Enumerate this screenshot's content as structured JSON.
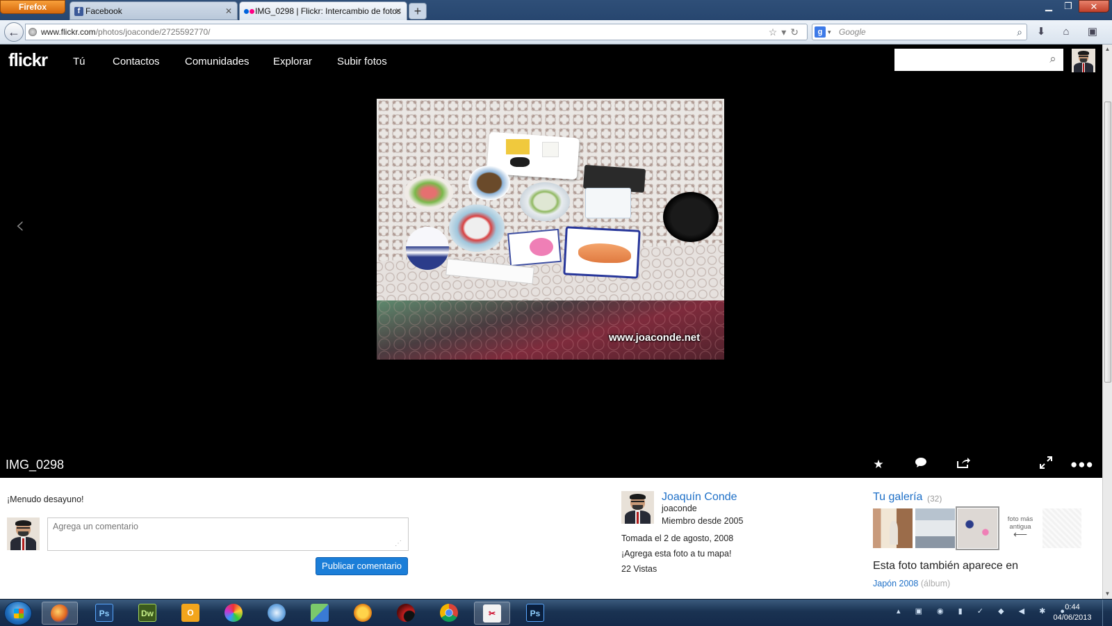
{
  "browser": {
    "app_button": "Firefox",
    "tabs": [
      {
        "label": "Facebook",
        "favicon": "facebook-icon",
        "active": false
      },
      {
        "label": "IMG_0298 | Flickr: Intercambio de fotos",
        "favicon": "flickr-icon",
        "active": true
      }
    ],
    "url_host": "www.flickr.com",
    "url_path": "/photos/joaconde/2725592770/",
    "search_engine": "Google",
    "search_placeholder": "Google"
  },
  "flickr": {
    "logo": "flickr",
    "nav": [
      "Tú",
      "Contactos",
      "Comunidades",
      "Explorar",
      "Subir fotos"
    ],
    "photo_title": "IMG_0298",
    "photo_watermark": "www.joaconde.net",
    "description": "¡Menudo desayuno!",
    "comment_placeholder": "Agrega un comentario",
    "post_button": "Publicar comentario",
    "owner": {
      "name": "Joaquín Conde",
      "username": "joaconde",
      "member_since": "Miembro desde 2005"
    },
    "taken_on": "Tomada el 2 de agosto, 2008",
    "add_to_map": "¡Agrega esta foto a tu mapa!",
    "views": "22 Vistas",
    "gallery": {
      "title": "Tu galería",
      "count": "(32)",
      "older_label": "foto más antigua",
      "older_arrow": "⟵"
    },
    "also_in": "Esta foto también aparece en",
    "album": {
      "name": "Japón 2008",
      "tag": "(álbum)"
    }
  },
  "taskbar": {
    "time": "0:44",
    "date": "04/06/2013"
  },
  "colors": {
    "flickr_blue": "#1d6fc7",
    "flickr_pink": "#ff0084",
    "button_blue": "#1b7ed8",
    "page_bg": "#000000"
  }
}
